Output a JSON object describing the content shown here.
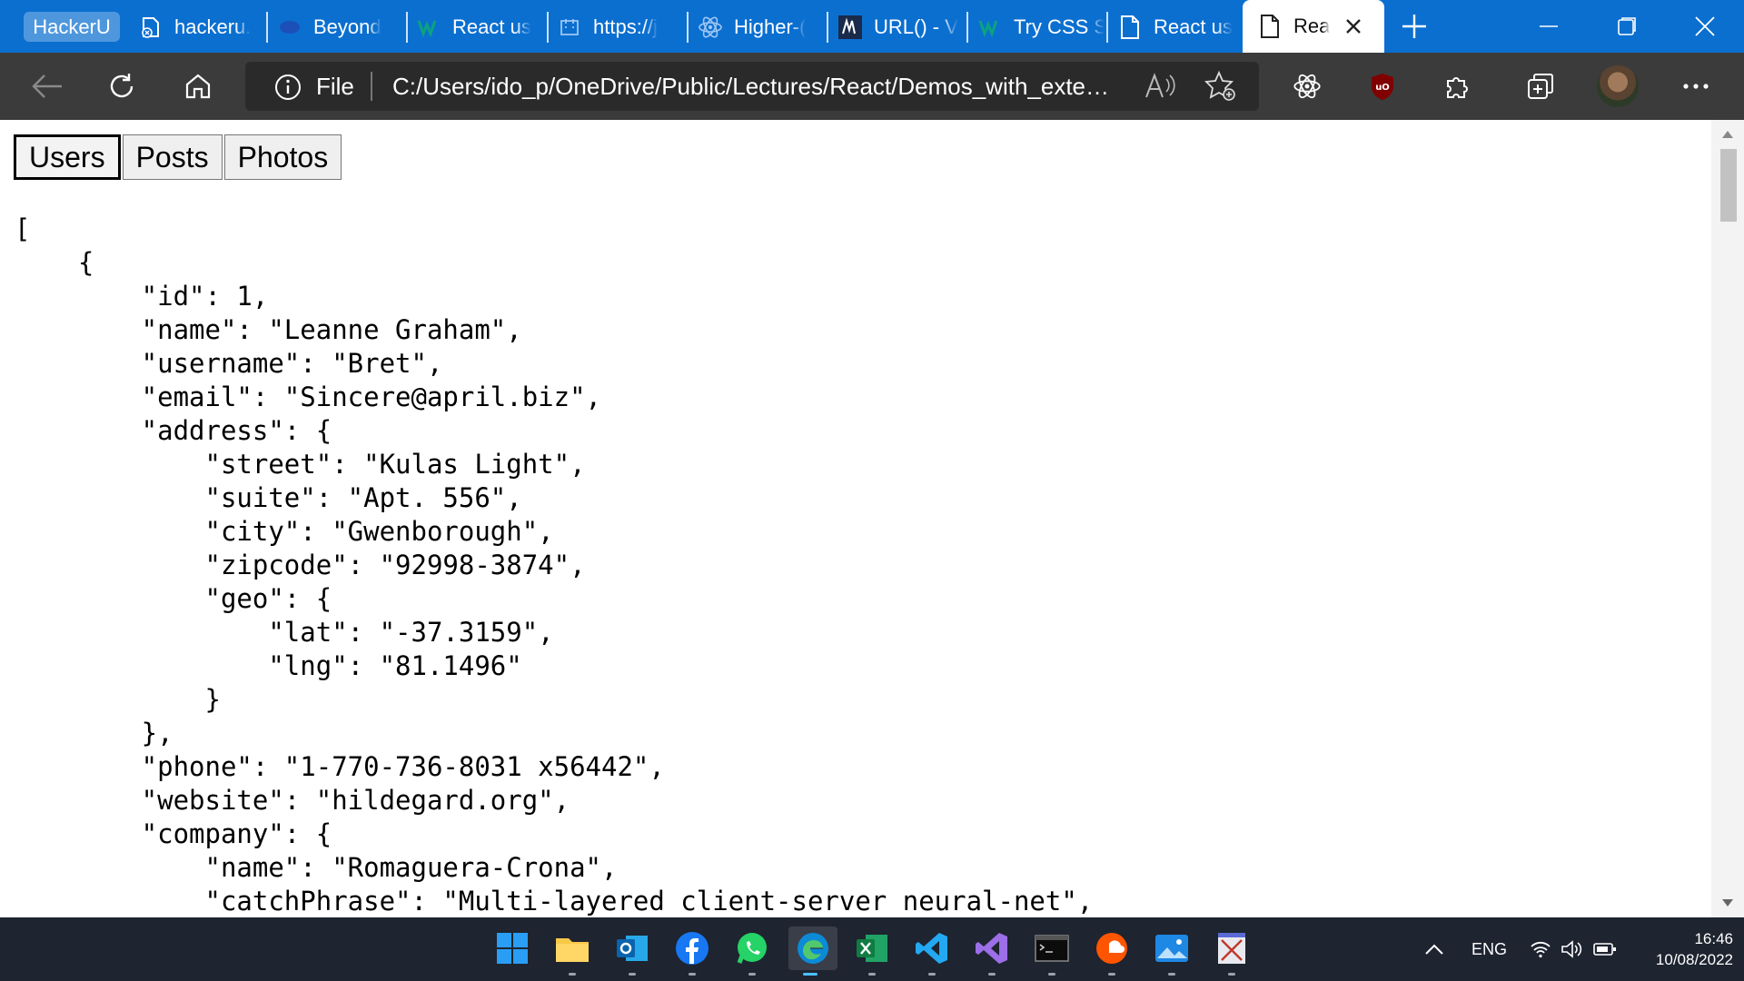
{
  "browser": {
    "tab_group_label": "HackerU",
    "tabs": [
      {
        "label": "hackeru.",
        "icon": "bee-icon"
      },
      {
        "label": "Beyond",
        "icon": "beyond-icon"
      },
      {
        "label": "React us",
        "icon": "w3schools-icon"
      },
      {
        "label": "https://j",
        "icon": "placeholder-icon"
      },
      {
        "label": "Higher-(",
        "icon": "react-icon"
      },
      {
        "label": "URL() - V",
        "icon": "mdn-icon"
      },
      {
        "label": "Try CSS S",
        "icon": "w3schools-icon"
      },
      {
        "label": "React us",
        "icon": "page-icon"
      }
    ],
    "active_tab": {
      "label": "Rea",
      "icon": "page-icon"
    },
    "address_scheme": "File",
    "address_url": "C:/Users/ido_p/OneDrive/Public/Lectures/React/Demos_with_external..."
  },
  "page": {
    "nav_buttons": [
      "Users",
      "Posts",
      "Photos"
    ],
    "json_lines": [
      "[",
      "    {",
      "        \"id\": 1,",
      "        \"name\": \"Leanne Graham\",",
      "        \"username\": \"Bret\",",
      "        \"email\": \"Sincere@april.biz\",",
      "        \"address\": {",
      "            \"street\": \"Kulas Light\",",
      "            \"suite\": \"Apt. 556\",",
      "            \"city\": \"Gwenborough\",",
      "            \"zipcode\": \"92998-3874\",",
      "            \"geo\": {",
      "                \"lat\": \"-37.3159\",",
      "                \"lng\": \"81.1496\"",
      "            }",
      "        },",
      "        \"phone\": \"1-770-736-8031 x56442\",",
      "        \"website\": \"hildegard.org\",",
      "        \"company\": {",
      "            \"name\": \"Romaguera-Crona\",",
      "            \"catchPhrase\": \"Multi-layered client-server neural-net\","
    ]
  },
  "taskbar": {
    "apps": [
      "windows-start-icon",
      "file-explorer-icon",
      "outlook-icon",
      "facebook-icon",
      "whatsapp-icon",
      "edge-icon",
      "excel-icon",
      "vscode-icon",
      "visual-studio-icon",
      "terminal-icon",
      "soundcloud-icon",
      "photos-icon",
      "snipping-tool-icon"
    ],
    "language": "ENG",
    "time": "16:46",
    "date": "10/08/2022"
  },
  "colors": {
    "tabstrip": "#0b6fd0",
    "toolbar": "#3b3b3b",
    "taskbar": "#1e2430"
  }
}
